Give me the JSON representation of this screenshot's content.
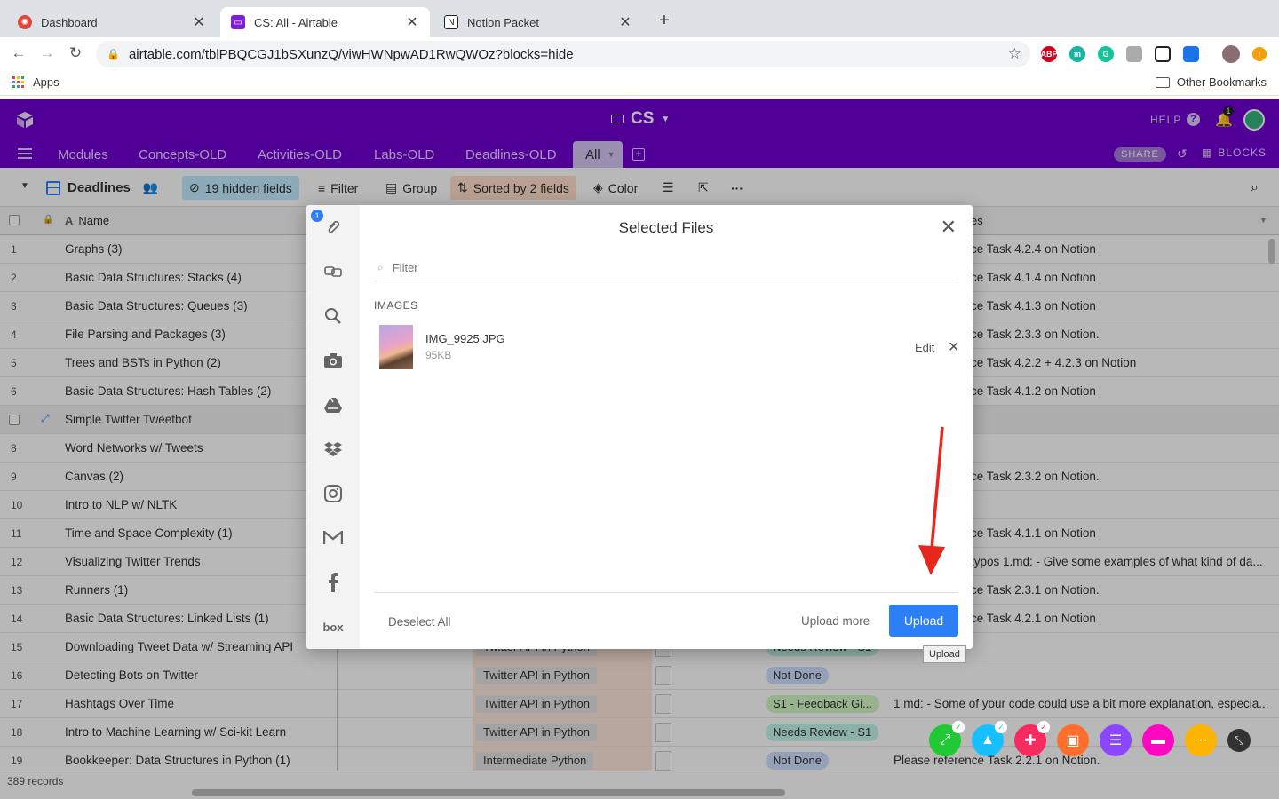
{
  "browser": {
    "tabs": [
      {
        "title": "Dashboard",
        "favicon_color": "#e0453a",
        "active": false
      },
      {
        "title": "CS: All - Airtable",
        "favicon_color": "#7e1ed6",
        "active": true
      },
      {
        "title": "Notion Packet",
        "favicon_color": "#222222",
        "active": false
      }
    ],
    "url": "airtable.com/tblPBQCGJ1bSXunzQ/viwHWNpwAD1RwQWOz?blocks=hide",
    "extensions": [
      "ABP",
      "m",
      "G",
      "",
      "",
      ""
    ],
    "bookmarks": {
      "apps": "Apps",
      "other": "Other Bookmarks"
    }
  },
  "base": {
    "name": "CS",
    "help": "HELP",
    "notification_count": "1",
    "share": "SHARE",
    "blocks": "BLOCKS",
    "accent": "#6f00d2"
  },
  "tables": [
    "Modules",
    "Concepts-OLD",
    "Activities-OLD",
    "Labs-OLD",
    "Deadlines-OLD",
    "All"
  ],
  "viewbar": {
    "view_name": "Deadlines",
    "hidden_fields": "19 hidden fields",
    "filter": "Filter",
    "group": "Group",
    "sorted": "Sorted by 2 fields",
    "color": "Color"
  },
  "grid": {
    "name_header": "Name",
    "notes_header": "es",
    "rows": [
      {
        "n": "1",
        "name": "Graphs (3)",
        "notes": "ce Task 4.2.4 on Notion"
      },
      {
        "n": "2",
        "name": "Basic Data Structures: Stacks (4)",
        "notes": "ce Task 4.1.4 on Notion"
      },
      {
        "n": "3",
        "name": "Basic Data Structures: Queues (3)",
        "notes": "ce Task 4.1.3 on Notion"
      },
      {
        "n": "4",
        "name": "File Parsing and Packages (3)",
        "notes": "ce Task 2.3.3 on Notion."
      },
      {
        "n": "5",
        "name": "Trees and BSTs in Python (2)",
        "notes": "ce Task 4.2.2 + 4.2.3 on Notion"
      },
      {
        "n": "6",
        "name": "Basic Data Structures: Hash Tables (2)",
        "notes": "ce Task 4.1.2 on Notion"
      },
      {
        "n": "",
        "name": "Simple Twitter Tweetbot",
        "notes": ""
      },
      {
        "n": "8",
        "name": "Word Networks w/ Tweets",
        "notes": ""
      },
      {
        "n": "9",
        "name": "Canvas (2)",
        "notes": "ce Task 2.3.2 on Notion."
      },
      {
        "n": "10",
        "name": "Intro to NLP w/ NLTK",
        "notes": ""
      },
      {
        "n": "11",
        "name": "Time and Space Complexity (1)",
        "notes": "ce Task 4.1.1 on Notion"
      },
      {
        "n": "12",
        "name": "Visualizing Twitter Trends",
        "notes": " typos 1.md: - Give some examples of what kind of da..."
      },
      {
        "n": "13",
        "name": "Runners (1)",
        "notes": "ce Task 2.3.1 on Notion."
      },
      {
        "n": "14",
        "name": "Basic Data Structures: Linked Lists (1)",
        "notes": "ce Task 4.2.1 on Notion"
      },
      {
        "n": "15",
        "name": "Downloading Tweet Data w/ Streaming API",
        "notes": ""
      },
      {
        "n": "16",
        "name": "Detecting Bots on Twitter",
        "notes": ""
      },
      {
        "n": "17",
        "name": "Hashtags Over Time",
        "notes": ""
      },
      {
        "n": "18",
        "name": "Intro to Machine Learning w/ Sci-kit Learn",
        "notes": ""
      },
      {
        "n": "19",
        "name": "Bookkeeper: Data Structures in Python (1)",
        "notes": ""
      }
    ],
    "lower_rows": [
      {
        "module": "Twitter API in Python",
        "status": "Needs Review - S1",
        "notes": ""
      },
      {
        "module": "Twitter API in Python",
        "status": "Not Done",
        "notes": ""
      },
      {
        "module": "Twitter API in Python",
        "status": "S1 - Feedback Gi...",
        "notes": "1.md: - Some of your code could use a bit more explanation, especia..."
      },
      {
        "module": "Twitter API in Python",
        "status": "Needs Review - S1",
        "notes": ""
      },
      {
        "module": "Intermediate Python",
        "status": "Not Done",
        "notes": "Please reference Task 2.2.1 on Notion."
      }
    ],
    "record_count": "389 records"
  },
  "modal": {
    "title": "Selected Files",
    "filter_placeholder": "Filter",
    "category": "IMAGES",
    "file_name": "IMG_9925.JPG",
    "file_size": "95KB",
    "edit": "Edit",
    "deselect_all": "Deselect All",
    "upload_more": "Upload more",
    "upload": "Upload",
    "tooltip": "Upload",
    "side_badge": "1",
    "side_label_box": "box"
  }
}
